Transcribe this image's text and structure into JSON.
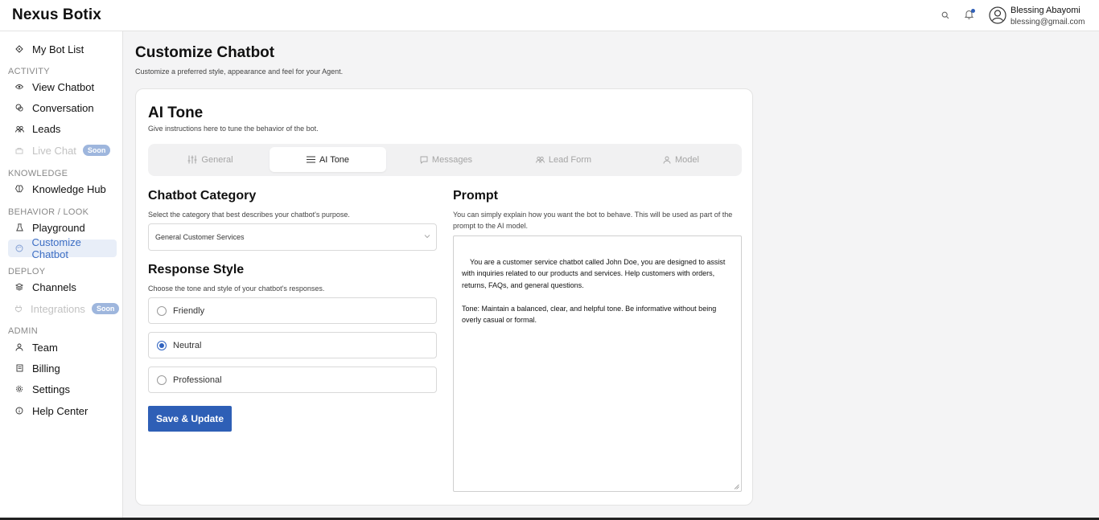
{
  "app": {
    "brand": "Nexus Botix"
  },
  "header": {
    "search_icon": "search-icon",
    "bell_icon": "bell-icon",
    "user": {
      "name": "Blessing Abayomi",
      "email": "blessing@gmail.com"
    }
  },
  "sidebar": {
    "items": [
      {
        "label": "My Bot List",
        "icon": "bot-icon"
      },
      {
        "label": "View Chatbot",
        "icon": "eye-icon"
      },
      {
        "label": "Conversation",
        "icon": "chat-icon"
      },
      {
        "label": "Leads",
        "icon": "users-icon"
      },
      {
        "label": "Live Chat",
        "icon": "livechat-icon",
        "badge": "Soon"
      },
      {
        "label": "Knowledge Hub",
        "icon": "brain-icon"
      },
      {
        "label": "Playground",
        "icon": "flask-icon"
      },
      {
        "label": "Customize Chatbot",
        "icon": "palette-icon"
      },
      {
        "label": "Channels",
        "icon": "layers-icon"
      },
      {
        "label": "Integrations",
        "icon": "plug-icon",
        "badge": "Soon"
      },
      {
        "label": "Team",
        "icon": "team-icon"
      },
      {
        "label": "Billing",
        "icon": "billing-icon"
      },
      {
        "label": "Settings",
        "icon": "gear-icon"
      },
      {
        "label": "Help Center",
        "icon": "info-icon"
      }
    ],
    "sections": {
      "activity": "ACTIVITY",
      "knowledge": "KNOWLEDGE",
      "behavior": "BEHAVIOR / LOOK",
      "deploy": "DEPLOY",
      "admin": "ADMIN"
    }
  },
  "page": {
    "title": "Customize Chatbot",
    "subtitle": "Customize a preferred style, appearance and feel for your Agent."
  },
  "card": {
    "title": "AI Tone",
    "subtitle": "Give instructions here to tune the behavior of the bot.",
    "tabs": [
      {
        "label": "General",
        "icon": "sliders-icon"
      },
      {
        "label": "AI Tone",
        "icon": "menu-icon"
      },
      {
        "label": "Messages",
        "icon": "message-icon"
      },
      {
        "label": "Lead Form",
        "icon": "users-icon"
      },
      {
        "label": "Model",
        "icon": "user-icon"
      }
    ],
    "active_tab": "AI Tone",
    "category": {
      "title": "Chatbot Category",
      "subtitle": "Select the category that best describes your chatbot's purpose.",
      "selected": "General Customer Services"
    },
    "response_style": {
      "title": "Response Style",
      "subtitle": "Choose the tone and style of your chatbot's responses.",
      "options": [
        "Friendly",
        "Neutral",
        "Professional"
      ],
      "selected": "Neutral"
    },
    "save_label": "Save & Update",
    "prompt": {
      "title": "Prompt",
      "subtitle": "You can simply explain how you want the bot to behave. This will be used as part of the prompt to the AI model.",
      "value": "You are a customer service chatbot called John Doe, you are designed to assist with inquiries related to our products and services. Help customers with orders, returns, FAQs, and general questions.\n\nTone: Maintain a balanced, clear, and helpful tone. Be informative without being overly casual or formal."
    }
  },
  "colors": {
    "accent": "#2e5fb6",
    "active_nav_bg": "#e8eef8",
    "soon_badge": "#9eb6dd"
  }
}
